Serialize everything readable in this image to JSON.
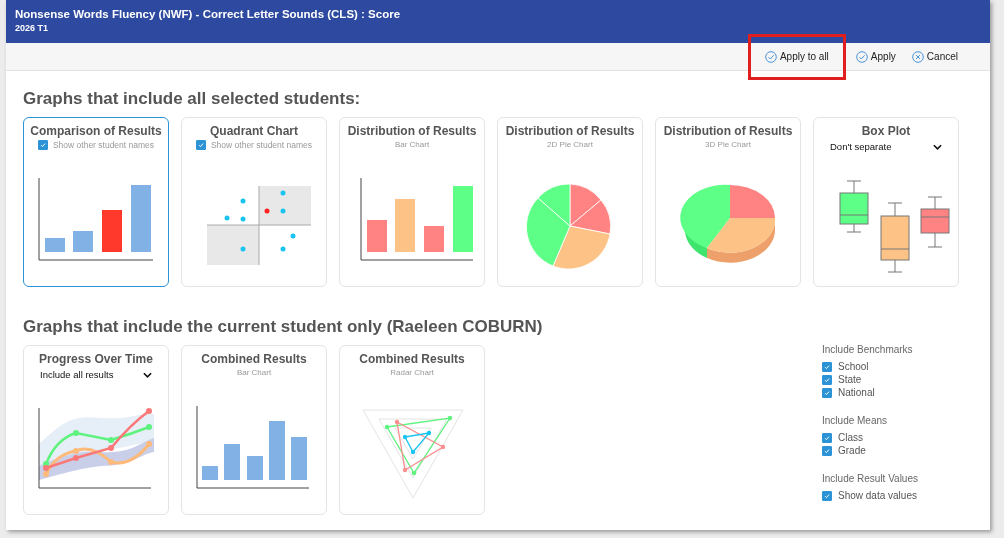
{
  "window": {
    "title": "Nonsense Words Fluency (NWF) - Correct Letter Sounds (CLS) : Score",
    "subtitle": "2026 T1"
  },
  "toolbar": [
    {
      "label": "Apply to all",
      "kind": "check",
      "highlighted": true
    },
    {
      "label": "Apply",
      "kind": "check",
      "highlighted": false
    },
    {
      "label": "Cancel",
      "kind": "cancel",
      "highlighted": false
    }
  ],
  "sections": [
    {
      "title": "Graphs that include all selected students:",
      "cards": [
        {
          "title": "Comparison of Results",
          "checkbox": {
            "label": "Show other student names",
            "checked": true
          },
          "kind": "comparison",
          "selected": true
        },
        {
          "title": "Quadrant Chart",
          "checkbox": {
            "label": "Show other student names",
            "checked": true
          },
          "kind": "quadrant",
          "selected": false
        },
        {
          "title": "Distribution of Results",
          "subtitle": "Bar Chart",
          "kind": "bar",
          "selected": false
        },
        {
          "title": "Distribution of Results",
          "subtitle": "2D Pie Chart",
          "kind": "pie",
          "selected": false
        },
        {
          "title": "Distribution of Results",
          "subtitle": "3D Pie Chart",
          "kind": "pie3d",
          "selected": false
        },
        {
          "title": "Box Plot",
          "dropdown": "Don't separate",
          "kind": "boxplot",
          "selected": false
        }
      ]
    },
    {
      "title": "Graphs that include the current student only (Raeleen COBURN)",
      "cards": [
        {
          "title": "Progress Over Time",
          "dropdown": "Include all results",
          "kind": "progress",
          "selected": false
        },
        {
          "title": "Combined Results",
          "subtitle": "Bar Chart",
          "kind": "combined",
          "selected": false
        },
        {
          "title": "Combined Results",
          "subtitle": "Radar Chart",
          "kind": "radar",
          "selected": false
        }
      ],
      "options": [
        {
          "heading": "Include Benchmarks",
          "items": [
            {
              "label": "School",
              "checked": true
            },
            {
              "label": "State",
              "checked": true
            },
            {
              "label": "National",
              "checked": true
            }
          ]
        },
        {
          "heading": "Include Means",
          "items": [
            {
              "label": "Class",
              "checked": true
            },
            {
              "label": "Grade",
              "checked": true
            }
          ]
        },
        {
          "heading": "Include Result Values",
          "items": [
            {
              "label": "Show data values",
              "checked": true
            }
          ]
        }
      ]
    }
  ]
}
